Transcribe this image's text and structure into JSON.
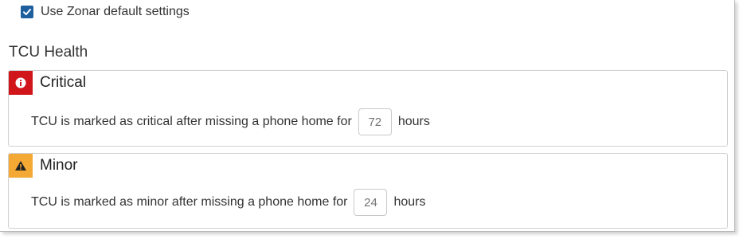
{
  "settings": {
    "use_default_label": "Use Zonar default settings",
    "use_default_checked": true
  },
  "tcu_health": {
    "title": "TCU Health",
    "critical": {
      "title": "Critical",
      "icon": "exclamation-circle-icon",
      "color": "#d0161b",
      "description": "TCU is marked as critical after missing a phone home for",
      "hours_placeholder": "72",
      "unit": "hours"
    },
    "minor": {
      "title": "Minor",
      "icon": "warning-triangle-icon",
      "color": "#f4a934",
      "description": "TCU is marked as minor after missing a phone home for",
      "hours_placeholder": "24",
      "unit": "hours"
    }
  },
  "colors": {
    "accent": "#1f5f9e"
  }
}
